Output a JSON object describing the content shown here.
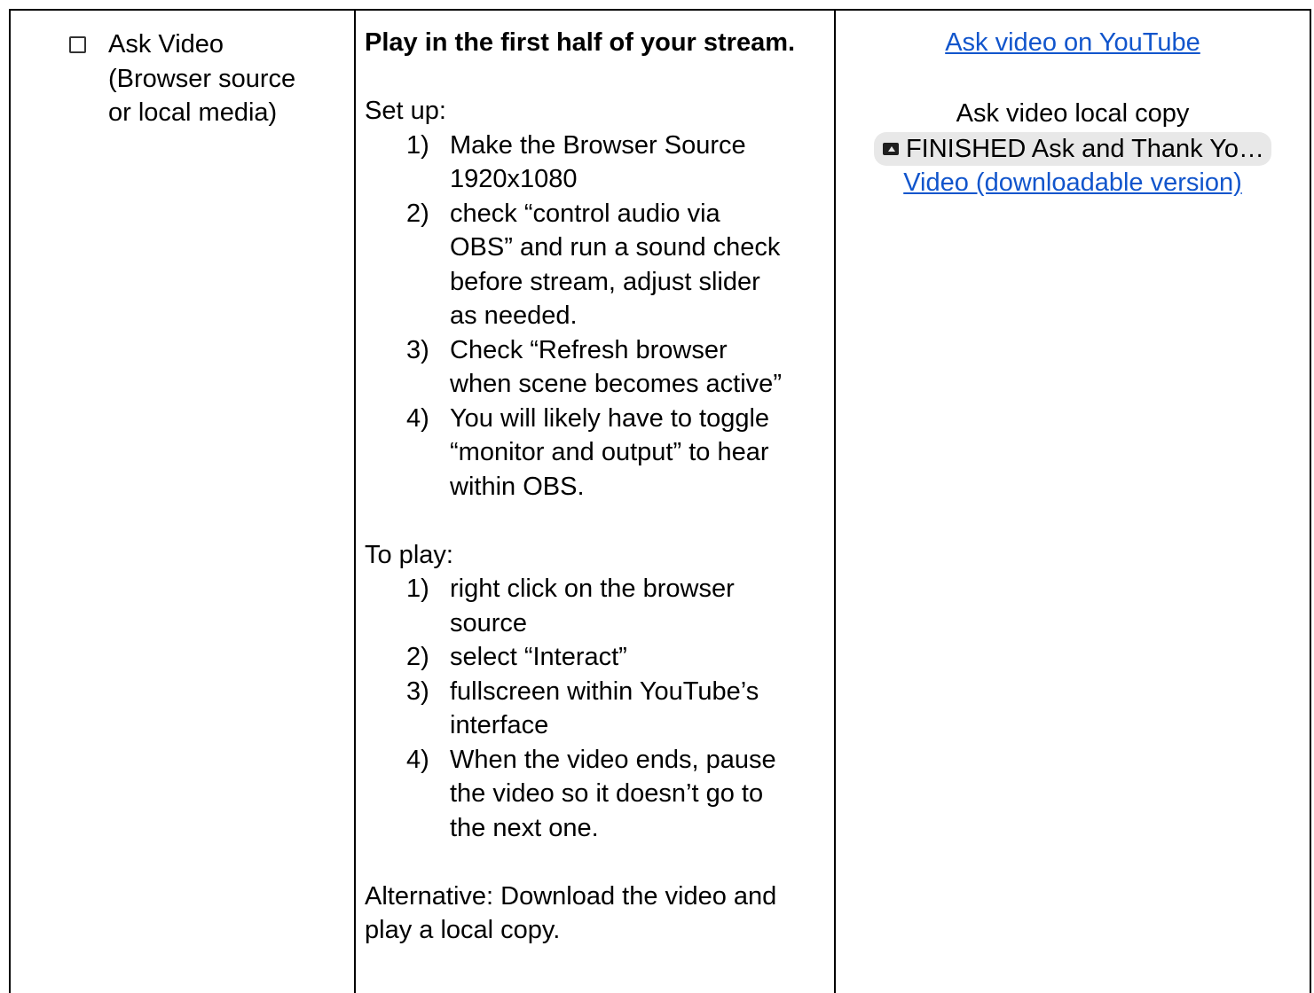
{
  "task": {
    "checked": false,
    "lines": [
      "Ask Video",
      "(Browser source",
      "or local media)"
    ]
  },
  "instructions": {
    "heading": "Play in the first half of your stream.",
    "setup_label": "Set up:",
    "setup_steps": [
      {
        "num": "1)",
        "lines": [
          "Make the Browser Source",
          "1920x1080"
        ]
      },
      {
        "num": "2)",
        "lines": [
          "check “control audio via",
          "OBS” and run a sound check",
          "before stream, adjust slider",
          "as needed."
        ]
      },
      {
        "num": "3)",
        "lines": [
          "Check “Refresh browser",
          "when scene becomes active”"
        ]
      },
      {
        "num": "4)",
        "lines": [
          "You will likely have to toggle",
          "“monitor and output” to hear",
          "within OBS."
        ]
      }
    ],
    "play_label": "To play:",
    "play_steps": [
      {
        "num": "1)",
        "lines": [
          "right click on the browser",
          "source"
        ]
      },
      {
        "num": "2)",
        "lines": [
          "select “Interact”"
        ]
      },
      {
        "num": "3)",
        "lines": [
          "fullscreen within YouTube’s",
          "interface"
        ]
      },
      {
        "num": "4)",
        "lines": [
          "When the video ends, pause",
          "the video so it doesn’t go to",
          "the next one."
        ]
      }
    ],
    "alternative": [
      "Alternative: Download the video and",
      "play a local copy."
    ]
  },
  "resources": {
    "youtube_link": "Ask video on YouTube",
    "local_label": "Ask video local copy",
    "drive_chip": "FINISHED Ask and Thank Yo…",
    "drive_chip_icon": "shared-drive-folder-icon",
    "download_link": "Video (downloadable version)"
  },
  "colors": {
    "link": "#1155cc",
    "chip_bg": "#e8e8e8"
  }
}
